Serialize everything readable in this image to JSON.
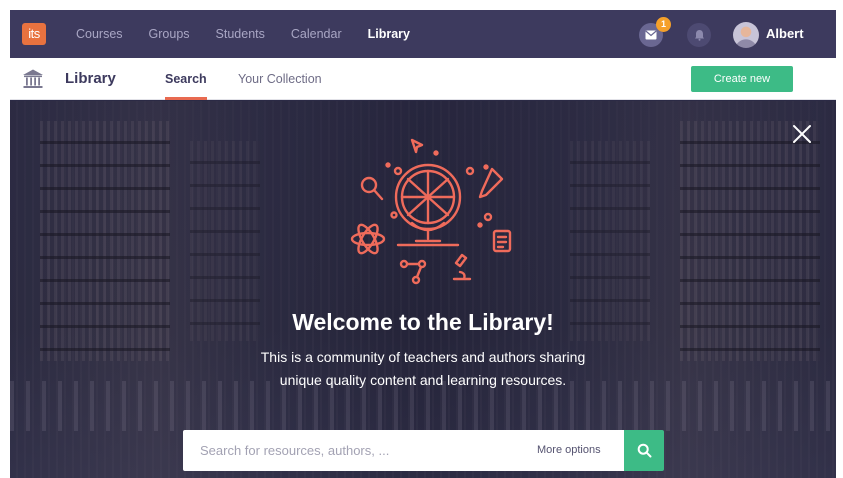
{
  "app": {
    "logo_text": "its"
  },
  "topnav": {
    "links": [
      {
        "label": "Courses"
      },
      {
        "label": "Groups"
      },
      {
        "label": "Students"
      },
      {
        "label": "Calendar"
      },
      {
        "label": "Library"
      }
    ],
    "active": "Library",
    "notifications_badge": "1",
    "user_name": "Albert"
  },
  "subnav": {
    "title": "Library",
    "tabs": [
      {
        "label": "Search"
      },
      {
        "label": "Your Collection"
      }
    ],
    "active_tab": "Search",
    "create_button": "Create new"
  },
  "hero": {
    "heading": "Welcome to the Library!",
    "description_line1": "This is a community of teachers and authors sharing",
    "description_line2": "unique quality content and learning resources."
  },
  "search": {
    "placeholder": "Search for resources, authors, ...",
    "more_options": "More options"
  },
  "colors": {
    "topnav_bg": "#3d3a5e",
    "accent_green": "#3dbb86",
    "accent_coral": "#e86a50",
    "badge_orange": "#f5a02a",
    "logo_orange": "#e8723f"
  },
  "icons": {
    "logo": "its-logo",
    "mail": "envelope-icon",
    "bell": "bell-icon",
    "library": "library-building-icon",
    "close": "close-icon",
    "search": "search-icon",
    "illustration": "globe-science-illustration"
  }
}
